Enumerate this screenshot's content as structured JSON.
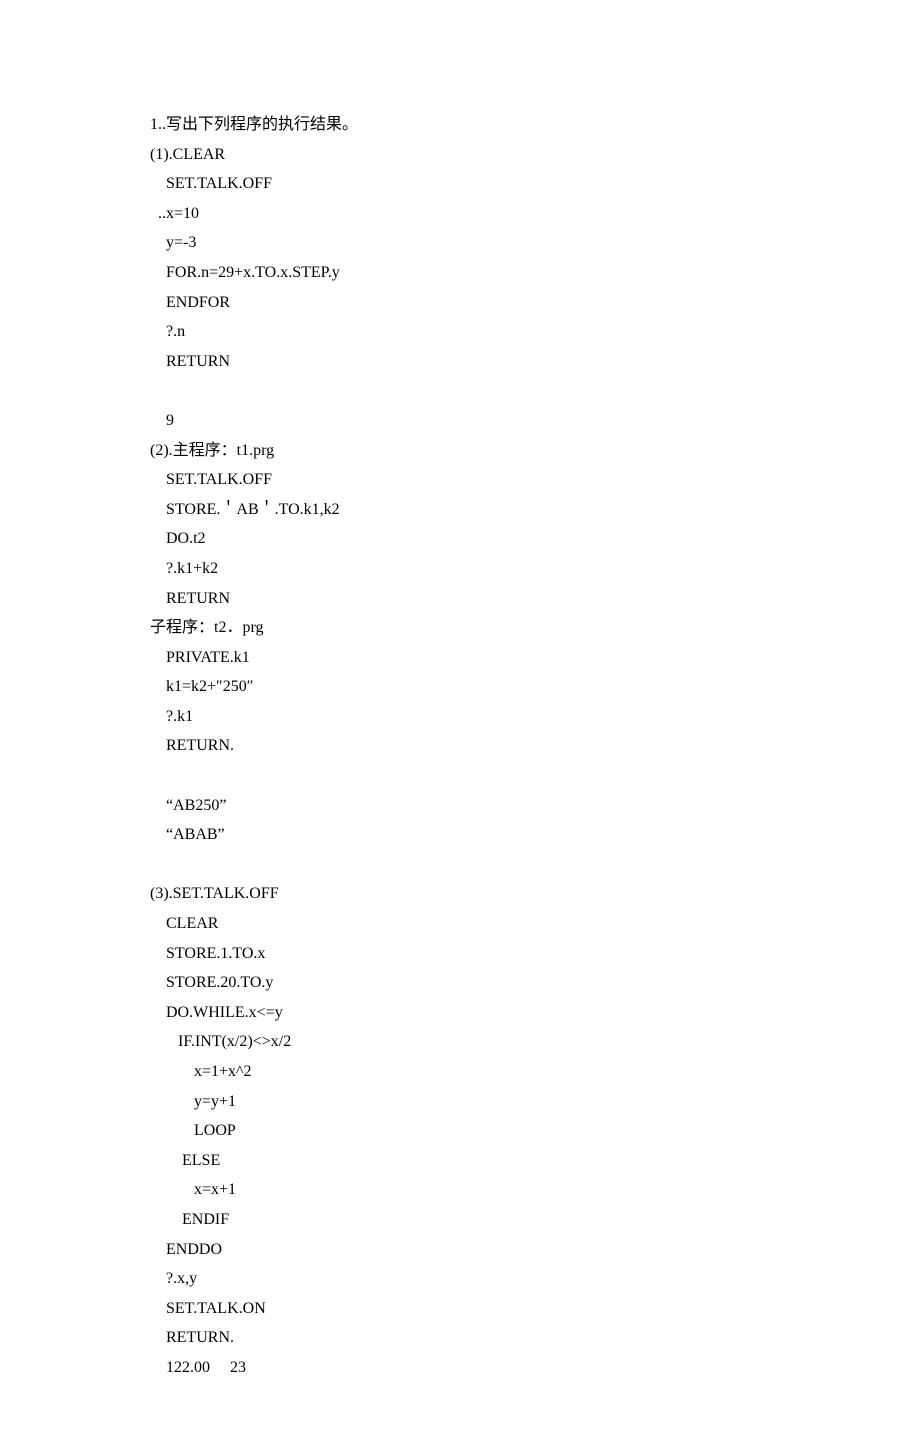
{
  "document": {
    "title": "1..写出下列程序的执行结果。",
    "sections": [
      {
        "header": "(1).CLEAR",
        "lines": [
          "    SET.TALK.OFF",
          "  ..x=10",
          "    y=-3",
          "    FOR.n=29+x.TO.x.STEP.y",
          "    ENDFOR",
          "    ?.n",
          "    RETURN",
          "",
          "    9"
        ]
      },
      {
        "header": "(2).主程序：t1.prg",
        "lines": [
          "    SET.TALK.OFF",
          "    STORE.＇AB＇.TO.k1,k2",
          "    DO.t2",
          "    ?.k1+k2",
          "    RETURN",
          "子程序：t2．prg",
          "    PRIVATE.k1",
          "    k1=k2+″250″",
          "    ?.k1",
          "    RETURN.",
          "",
          "    “AB250”",
          "    “ABAB”",
          ""
        ]
      },
      {
        "header": "(3).SET.TALK.OFF",
        "lines": [
          "    CLEAR",
          "    STORE.1.TO.x",
          "    STORE.20.TO.y",
          "    DO.WHILE.x<=y",
          "       IF.INT(x/2)<>x/2",
          "           x=1+x^2",
          "           y=y+1",
          "           LOOP",
          "        ELSE",
          "           x=x+1",
          "        ENDIF",
          "    ENDDO",
          "    ?.x,y",
          "    SET.TALK.ON",
          "    RETURN.",
          "    122.00     23"
        ]
      }
    ]
  }
}
